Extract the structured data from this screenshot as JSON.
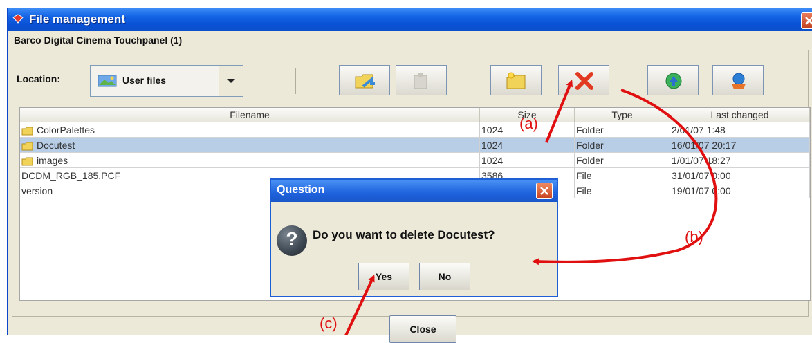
{
  "window": {
    "title": "File management"
  },
  "panel": {
    "group_title": "Barco Digital Cinema Touchpanel (1)"
  },
  "location": {
    "label": "Location:",
    "value": "User files"
  },
  "toolbar": {
    "buttons": [
      {
        "icon": "copy-folder-icon"
      },
      {
        "icon": "paste-icon"
      },
      {
        "icon": "new-folder-icon"
      },
      {
        "icon": "delete-icon"
      },
      {
        "icon": "upload-icon"
      },
      {
        "icon": "download-icon"
      }
    ]
  },
  "table": {
    "columns": [
      "Filename",
      "Size",
      "Type",
      "Last changed"
    ],
    "rows": [
      {
        "name": "ColorPalettes",
        "size": "1024",
        "type": "Folder",
        "changed": "2/01/07 1:48",
        "folder": true,
        "selected": false
      },
      {
        "name": "Docutest",
        "size": "1024",
        "type": "Folder",
        "changed": "16/01/07 20:17",
        "folder": true,
        "selected": true
      },
      {
        "name": "images",
        "size": "1024",
        "type": "Folder",
        "changed": "1/01/07 18:27",
        "folder": true,
        "selected": false
      },
      {
        "name": "DCDM_RGB_185.PCF",
        "size": "3586",
        "type": "File",
        "changed": "31/01/07 0:00",
        "folder": false,
        "selected": false
      },
      {
        "name": "version",
        "size": "",
        "type": "File",
        "changed": "19/01/07 0:00",
        "folder": false,
        "selected": false
      }
    ]
  },
  "dialog": {
    "title": "Question",
    "message": "Do you want to delete Docutest?",
    "yes_label": "Yes",
    "no_label": "No"
  },
  "footer": {
    "close_label": "Close"
  },
  "annotations": {
    "a": "(a)",
    "b": "(b)",
    "c": "(c)"
  },
  "colors": {
    "title_bar": "#0a52d6",
    "selection": "#b8cde6",
    "annotation": "#e01010",
    "window_bg": "#ece9d8"
  }
}
